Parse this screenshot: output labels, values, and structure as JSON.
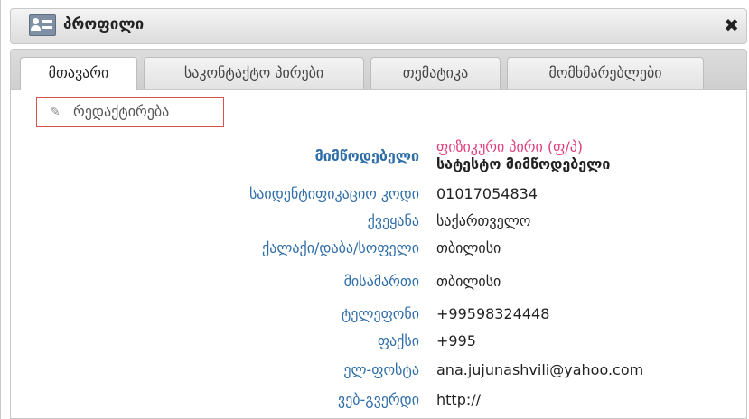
{
  "dialog": {
    "title": "პროფილი",
    "close_glyph": "✖"
  },
  "tabs": [
    {
      "label": "მთავარი",
      "active": true
    },
    {
      "label": "საკონტაქტო პირები",
      "active": false
    },
    {
      "label": "თემატიკა",
      "active": false
    },
    {
      "label": "მომხმარებლები",
      "active": false
    }
  ],
  "edit_button": {
    "icon": "pencil-icon",
    "label": "რედაქტირება"
  },
  "fields": {
    "supplier": {
      "label": "მიმწოდებელი",
      "type_value": "ფიზიკური პირი (ფ/პ)",
      "name_value": "სატესტო მიმწოდებელი"
    },
    "id_code": {
      "label": "საიდენტიფიკაციო კოდი",
      "value": "01017054834"
    },
    "country": {
      "label": "ქვეყანა",
      "value": "საქართველო"
    },
    "city": {
      "label": "ქალაქი/დაბა/სოფელი",
      "value": "თბილისი"
    },
    "address": {
      "label": "მისამართი",
      "value": "თბილისი"
    },
    "phone": {
      "label": "ტელეფონი",
      "value": "+99598324448"
    },
    "fax": {
      "label": "ფაქსი",
      "value": "+995"
    },
    "email": {
      "label": "ელ-ფოსტა",
      "value": "ana.jujunashvili@yahoo.com"
    },
    "website": {
      "label": "ვებ-გვერდი",
      "value": "http://"
    }
  },
  "colors": {
    "label_blue": "#2f6da8",
    "supplier_type_pink": "#e0407a",
    "edit_border_red": "#d9534f"
  }
}
